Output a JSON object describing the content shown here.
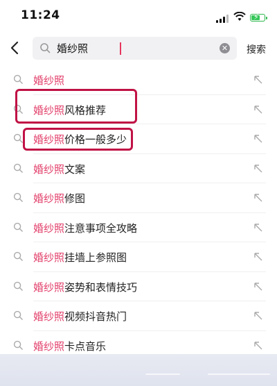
{
  "status_bar": {
    "time": "11:24"
  },
  "search": {
    "value": "婚纱照",
    "placeholder": "",
    "submit_label": "搜索"
  },
  "suggestions": [
    {
      "keyword": "婚纱照",
      "suffix": ""
    },
    {
      "keyword": "婚纱照",
      "suffix": "风格推荐"
    },
    {
      "keyword": "婚纱照",
      "suffix": "价格一般多少"
    },
    {
      "keyword": "婚纱照",
      "suffix": "文案"
    },
    {
      "keyword": "婚纱照",
      "suffix": "修图"
    },
    {
      "keyword": "婚纱照",
      "suffix": "注意事项全攻略"
    },
    {
      "keyword": "婚纱照",
      "suffix": "挂墙上参照图"
    },
    {
      "keyword": "婚纱照",
      "suffix": "姿势和表情技巧"
    },
    {
      "keyword": "婚纱照",
      "suffix": "视频抖音热门"
    },
    {
      "keyword": "婚纱照",
      "suffix": "卡点音乐"
    }
  ],
  "colors": {
    "keyword": "#e23f6a",
    "highlight_box": "#c01245",
    "battery": "#35c759"
  },
  "battery_level": 0.7
}
